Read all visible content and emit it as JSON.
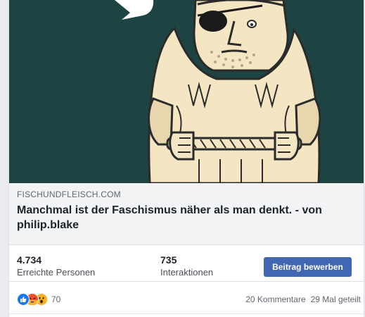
{
  "link": {
    "domain": "FISCHUNDFLEISCH.COM",
    "headline": "Manchmal ist der Faschismus näher als man denkt. - von philip.blake"
  },
  "stats": {
    "reach": {
      "value": "4.734",
      "label": "Erreichte Personen"
    },
    "engagement": {
      "value": "735",
      "label": "Interaktionen"
    },
    "boost_label": "Beitrag bewerben"
  },
  "reactions": {
    "icons": [
      "like-icon",
      "angry-icon",
      "wow-icon"
    ],
    "count": "70",
    "comments": "20 Kommentare",
    "shares": "29 Mal geteilt"
  },
  "colors": {
    "artwork_background": "#1d4343",
    "artwork_line": "#f4e6c2",
    "boost_button": "#4267b2"
  }
}
